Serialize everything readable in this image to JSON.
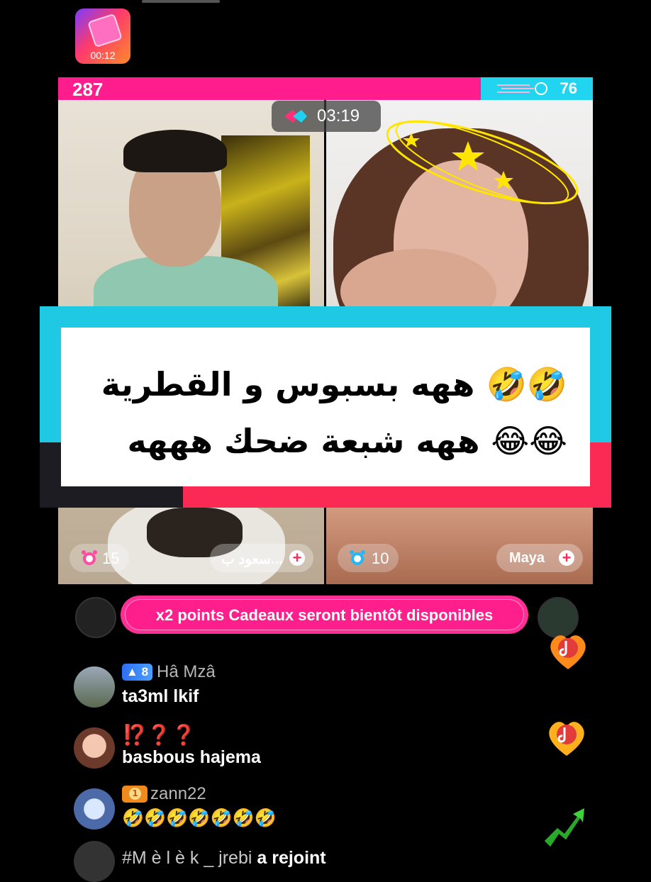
{
  "gift_card": {
    "timer": "00:12",
    "icon": "gift-box-icon"
  },
  "battle": {
    "score_left": "287",
    "score_right": "76",
    "pink_fraction": 0.79,
    "timer": "03:19",
    "left_bottom": {
      "count": "15",
      "name": "سعود ب..."
    },
    "right_bottom": {
      "count": "10",
      "name": "Maya"
    }
  },
  "overlay": {
    "line1": "🤣🤣 ههه بسبوس و القطرية",
    "line2": "😂😂 ههه شبعة ضحك هههه"
  },
  "banner": {
    "text": "x2 points Cadeaux seront bientôt disponibles"
  },
  "chat": [
    {
      "level": "8",
      "user": "Hâ Mzâ",
      "message": "ta3ml lkif"
    },
    {
      "user": "⁉️❓❓",
      "message": "basbous hajema"
    },
    {
      "user": "zann22",
      "message": "🤣🤣🤣🤣🤣🤣🤣"
    }
  ],
  "join": {
    "user": "#M è l è k _ jrebi",
    "action": "a rejoint"
  },
  "colors": {
    "pink": "#ff1d8e",
    "cyan": "#21d4f0",
    "red": "#fb2a55"
  }
}
